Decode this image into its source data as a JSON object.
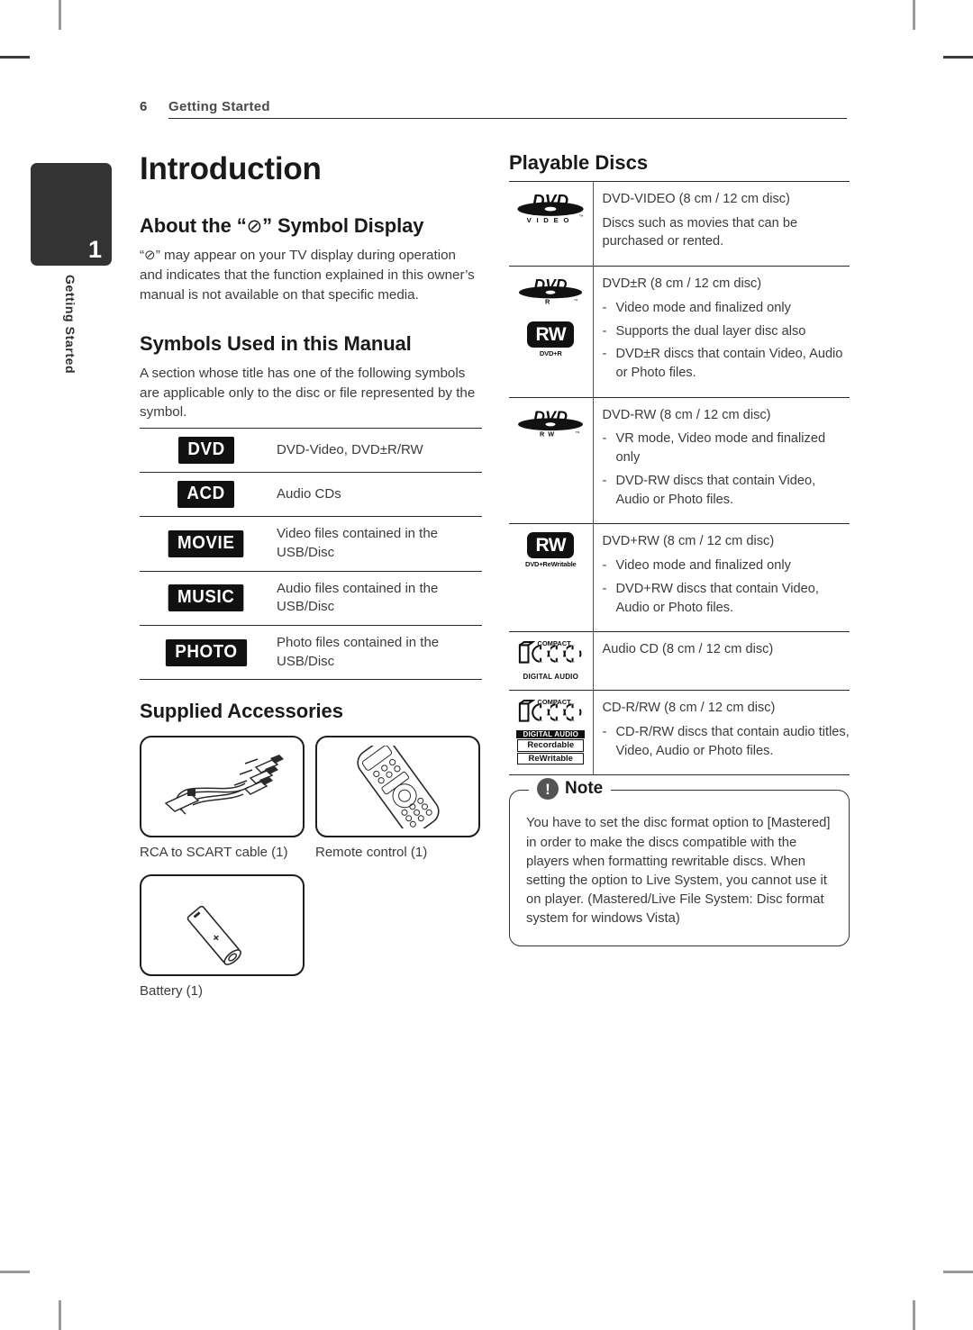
{
  "header": {
    "page_number": "6",
    "section_title": "Getting Started"
  },
  "sidebar": {
    "chapter_number": "1",
    "chapter_label": "Getting Started"
  },
  "left_column": {
    "doc_title": "Introduction",
    "symbol_section": {
      "heading_before": "About the “",
      "heading_symbol": "⊘",
      "heading_after": "” Symbol Display",
      "body": "“⊘” may appear on your TV display during operation and indicates that the function explained in this owner’s manual is not available on that specific media."
    },
    "symbols_manual": {
      "heading": "Symbols Used in this Manual",
      "body": "A section whose title has one of the following symbols are applicable only to the disc or file represented by the symbol.",
      "rows": [
        {
          "badge": "DVD",
          "description": "DVD-Video, DVD±R/RW"
        },
        {
          "badge": "ACD",
          "description": "Audio CDs"
        },
        {
          "badge": "MOVIE",
          "description": "Video files contained in the USB/Disc"
        },
        {
          "badge": "MUSIC",
          "description": "Audio files contained in the USB/Disc"
        },
        {
          "badge": "PHOTO",
          "description": "Photo files contained in the USB/Disc"
        }
      ]
    },
    "accessories": {
      "heading": "Supplied Accessories",
      "items": [
        {
          "icon": "rca-to-scart-cable-icon",
          "caption": "RCA to SCART cable (1)"
        },
        {
          "icon": "remote-control-icon",
          "caption": "Remote control (1)"
        },
        {
          "icon": "battery-icon",
          "caption": "Battery (1)"
        }
      ]
    }
  },
  "right_column": {
    "heading": "Playable Discs",
    "rows": [
      {
        "logos": [
          "dvd-video-logo"
        ],
        "title": "DVD-VIDEO (8 cm / 12 cm disc)",
        "subtitle": "Discs such as movies that can be purchased or rented.",
        "bullets": []
      },
      {
        "logos": [
          "dvd-r-logo",
          "rw-dvd-plus-r-logo"
        ],
        "title": "DVD±R (8 cm / 12 cm disc)",
        "subtitle": "",
        "bullets": [
          "Video mode and finalized only",
          "Supports the dual layer disc also",
          "DVD±R discs that contain Video, Audio or Photo files."
        ]
      },
      {
        "logos": [
          "dvd-rw-logo"
        ],
        "title": "DVD-RW (8 cm / 12 cm disc)",
        "subtitle": "",
        "bullets": [
          "VR mode, Video mode and finalized only",
          "DVD-RW discs that contain Video, Audio or Photo files."
        ]
      },
      {
        "logos": [
          "rw-dvd-plus-rewritable-logo"
        ],
        "title": "DVD+RW (8 cm / 12 cm disc)",
        "subtitle": "",
        "bullets": [
          "Video mode and finalized only",
          "DVD+RW discs that contain Video, Audio or Photo files."
        ]
      },
      {
        "logos": [
          "compact-disc-digital-audio-logo"
        ],
        "title": "Audio CD (8 cm / 12 cm disc)",
        "subtitle": "",
        "bullets": []
      },
      {
        "logos": [
          "compact-disc-recordable-rewritable-logo"
        ],
        "title": "CD-R/RW (8 cm / 12 cm disc)",
        "subtitle": "",
        "bullets": [
          "CD-R/RW discs that contain audio titles, Video, Audio or Photo files."
        ]
      }
    ],
    "logo_captions": {
      "dvd_video": "V I D E O",
      "dvd_r": "R",
      "dvd_rw": "R W",
      "rw_dvd_plus_r": "DVD+R",
      "rw_dvd_plus_rewritable": "DVD+ReWritable",
      "compact": "COMPACT",
      "digital_audio": "DIGITAL AUDIO",
      "recordable": "Recordable",
      "rewritable": "ReWritable",
      "disc_word": "disc"
    },
    "note": {
      "badge": "!",
      "title": "Note",
      "body": "You have to set the disc format option to [Mastered] in order to make the discs compatible with the players when formatting rewritable discs. When setting the option to Live System, you cannot use it on player. (Mastered/Live File System: Disc format system for windows Vista)"
    }
  },
  "colors": {
    "ink": "#231f20",
    "rule": "#2b2b2b",
    "chapter_tab": "#333333",
    "note_badge": "#545454"
  }
}
